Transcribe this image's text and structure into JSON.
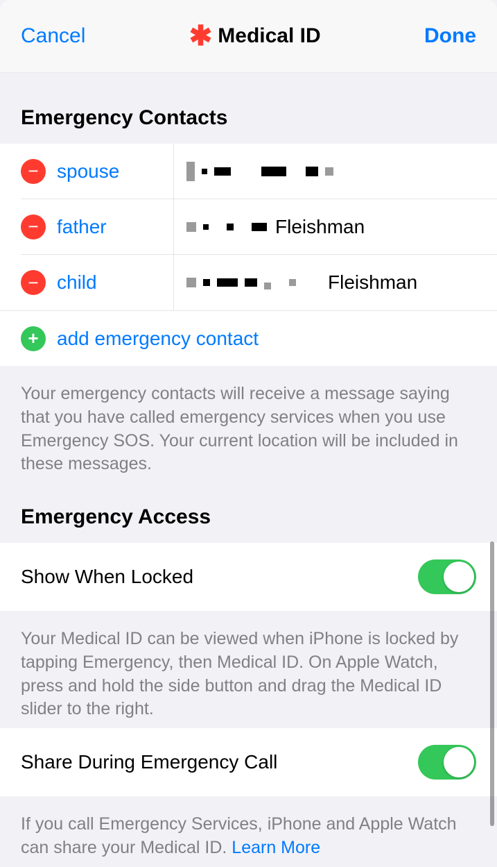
{
  "nav": {
    "cancel": "Cancel",
    "title": "Medical ID",
    "done": "Done"
  },
  "emergency_contacts": {
    "header": "Emergency Contacts",
    "rows": [
      {
        "relation": "spouse",
        "name_suffix": ""
      },
      {
        "relation": "father",
        "name_suffix": "Fleishman"
      },
      {
        "relation": "child",
        "name_suffix": "Fleishman"
      }
    ],
    "add_label": "add emergency contact",
    "footer": "Your emergency contacts will receive a message saying that you have called emergency services when you use Emergency SOS. Your current location will be included in these messages."
  },
  "emergency_access": {
    "header": "Emergency Access",
    "show_when_locked": {
      "label": "Show When Locked",
      "on": true,
      "footer": "Your Medical ID can be viewed when iPhone is locked by tapping Emergency, then Medical ID. On Apple Watch, press and hold the side button and drag the Medical ID slider to the right."
    },
    "share_during_call": {
      "label": "Share During Emergency Call",
      "on": true,
      "footer_prefix": "If you call Emergency Services, iPhone and Apple Watch can share your Medical ID. ",
      "learn_more": "Learn More"
    }
  }
}
